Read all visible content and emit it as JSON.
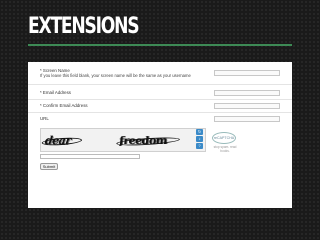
{
  "slide": {
    "title": "EXTENSIONS"
  },
  "form": {
    "screen_name": {
      "label": "* Screen Name",
      "help": "If you leave this field blank, your screen name will be the same as your username"
    },
    "email": {
      "label": "* Email Address"
    },
    "confirm_email": {
      "label": "* Confirm Email Address"
    },
    "url": {
      "label": "URL"
    },
    "captcha": {
      "word1": "dear",
      "word2": "freedom",
      "refresh_icon": "refresh-icon",
      "audio_icon": "audio-icon",
      "help_icon": "help-icon",
      "logo_text": "reCAPTCHA",
      "logo_caption": "stop spam. read books."
    },
    "submit_label": "Submit"
  },
  "colors": {
    "background": "#1a1a1a",
    "title": "#ffffff",
    "rule": "#3d8a55",
    "captcha_buttons": "#3a8ac8"
  }
}
